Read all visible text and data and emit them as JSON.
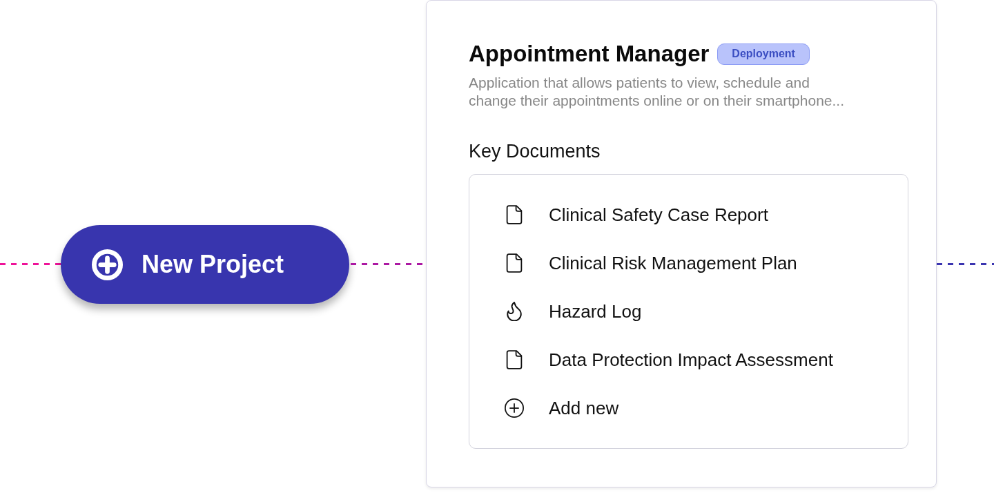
{
  "new_project_button": {
    "label": "New Project"
  },
  "project_card": {
    "title": "Appointment Manager",
    "badge": "Deployment",
    "description": "Application that allows patients to view, schedule and change their appointments online or on their smartphone...",
    "key_documents": {
      "heading": "Key Documents",
      "items": [
        {
          "kind": "document",
          "label": "Clinical Safety Case Report"
        },
        {
          "kind": "document",
          "label": "Clinical Risk Management Plan"
        },
        {
          "kind": "hazard",
          "label": "Hazard Log"
        },
        {
          "kind": "document",
          "label": "Data Protection Impact Assessment"
        },
        {
          "kind": "add",
          "label": "Add new"
        }
      ]
    }
  }
}
